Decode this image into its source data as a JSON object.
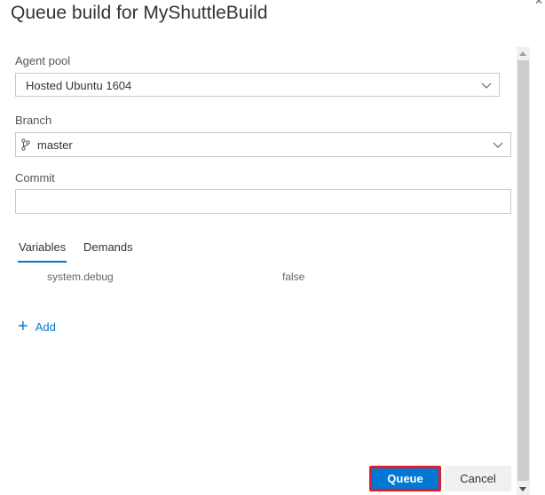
{
  "dialog": {
    "title": "Queue build for MyShuttleBuild"
  },
  "agent_pool": {
    "label": "Agent pool",
    "value": "Hosted Ubuntu 1604"
  },
  "branch": {
    "label": "Branch",
    "value": "master"
  },
  "commit": {
    "label": "Commit",
    "value": ""
  },
  "tabs": [
    {
      "label": "Variables",
      "active": true
    },
    {
      "label": "Demands",
      "active": false
    }
  ],
  "variables": [
    {
      "name": "system.debug",
      "value": "false"
    }
  ],
  "add": {
    "label": "Add"
  },
  "buttons": {
    "queue_label": "Queue",
    "cancel_label": "Cancel"
  },
  "colors": {
    "accent": "#0078d4",
    "highlight_border": "#e21b2c"
  },
  "icons": {
    "dropdown": "chevron-down-icon",
    "branch": "git-branch-icon",
    "add": "plus-icon"
  }
}
